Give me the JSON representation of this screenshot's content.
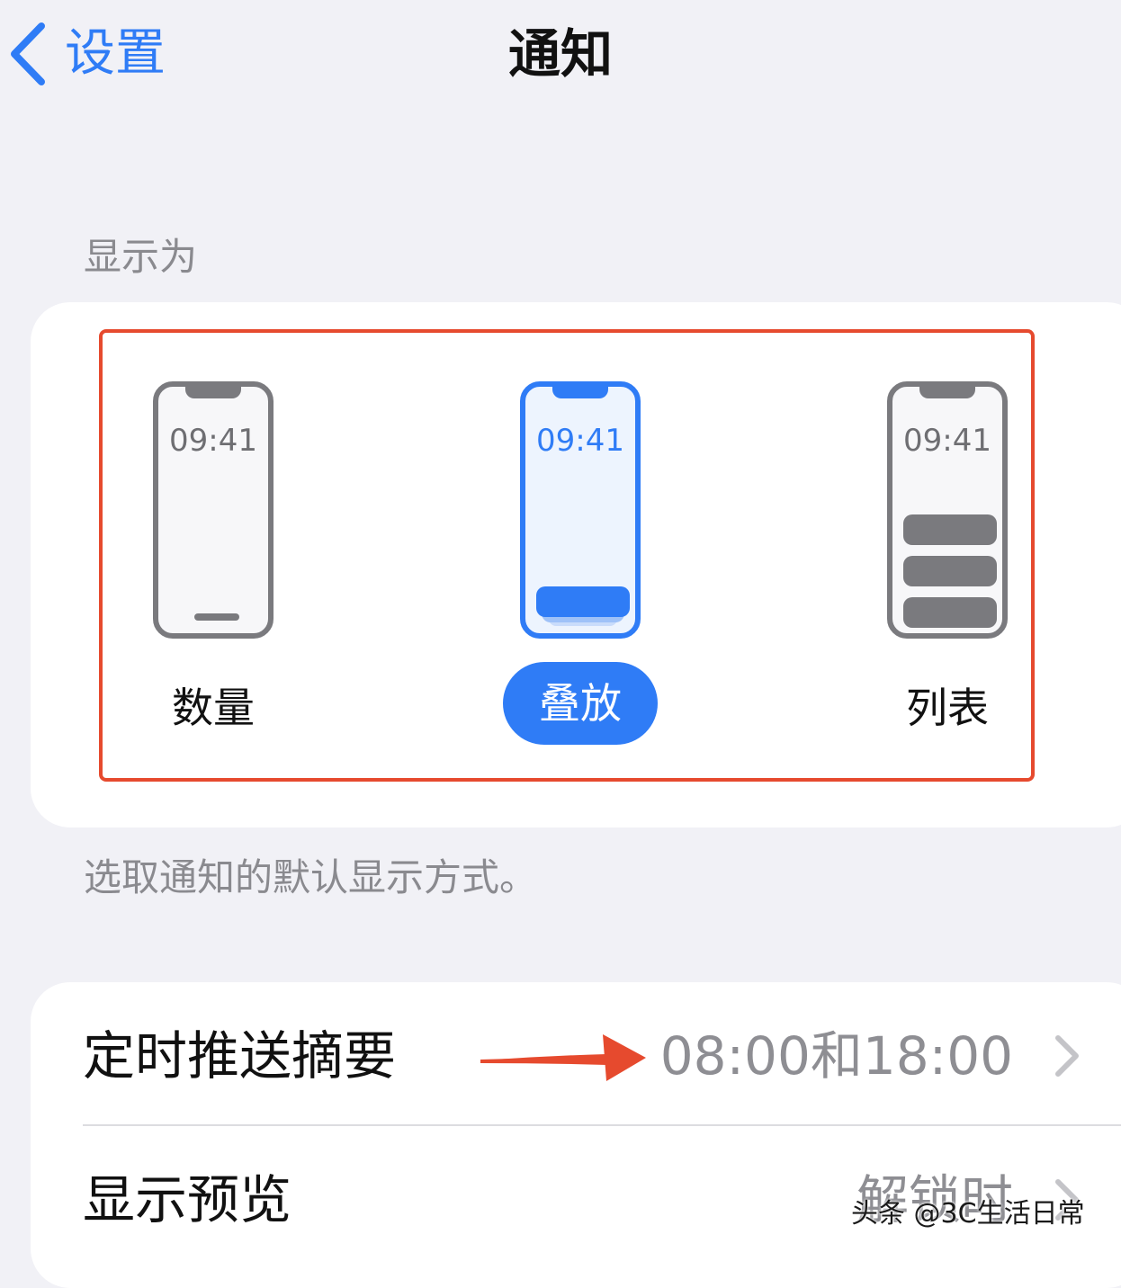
{
  "nav": {
    "back_label": "设置",
    "title": "通知"
  },
  "display_as": {
    "header": "显示为",
    "footer": "选取通知的默认显示方式。",
    "options": [
      {
        "label": "数量",
        "time": "09:41",
        "selected": false
      },
      {
        "label": "叠放",
        "time": "09:41",
        "selected": true
      },
      {
        "label": "列表",
        "time": "09:41",
        "selected": false
      }
    ]
  },
  "rows": [
    {
      "title": "定时推送摘要",
      "value": "08:00和18:00"
    },
    {
      "title": "显示预览",
      "value": "解锁时"
    }
  ],
  "watermark": "头条 @3C生活日常",
  "colors": {
    "accent": "#2f7cf6",
    "annotation": "#e64a2e",
    "background": "#f1f1f6"
  }
}
